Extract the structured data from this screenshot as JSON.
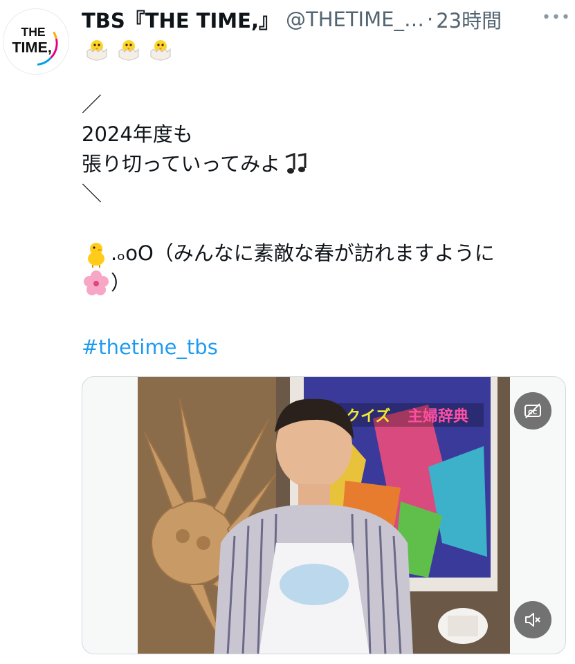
{
  "author": {
    "avatar_text_line1": "THE",
    "avatar_text_line2": "TIME,",
    "display_name": "TBS『THE TIME,』",
    "handle": "@THETIME_…",
    "separator": "·",
    "timestamp": "23時間",
    "chick_count": 3
  },
  "menu": {
    "more_icon": "more-horizontal-icon",
    "label": "•••"
  },
  "tweet": {
    "line1": "／",
    "line2": "2024年度も",
    "line3": "張り切っていってみよ",
    "line3_emoji": "musical-notes",
    "line4": "＼",
    "line5_text": ".ₒoO（みんなに素敵な春が訪れますように",
    "line5_emoji": "baby-chick",
    "line6_text": "）",
    "line6_emoji": "cherry-blossom",
    "hashtag": "#thetime_tbs"
  },
  "media": {
    "overlay_caption_left": "クイズ",
    "overlay_caption_right": "主婦辞典",
    "captions_button_icon": "captions-off-icon",
    "mute_button_icon": "volume-muted-icon"
  },
  "colors": {
    "link": "#1d9bf0",
    "text": "#0f1419",
    "secondary": "#536471"
  }
}
